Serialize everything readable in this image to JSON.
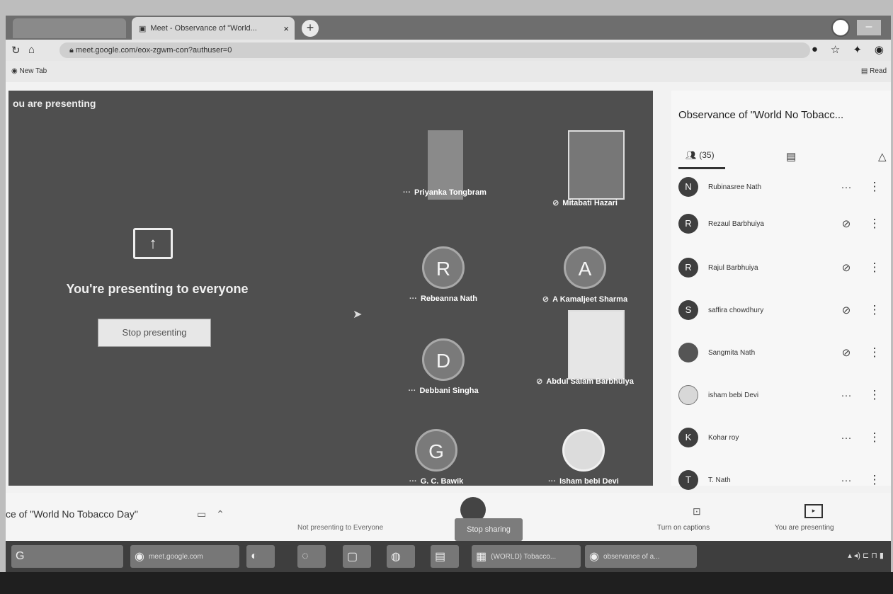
{
  "browser": {
    "tab_title": "Meet - Observance of \"World...",
    "tab_close": "×",
    "new_tab": "+",
    "url": "meet.google.com/eox-zgwm-con?authuser=0",
    "bookmark_new_tab": "New Tab",
    "bookmark_reading_list": "Read"
  },
  "stage": {
    "label": "ou are presenting",
    "message": "You're presenting to everyone",
    "stop_button": "Stop presenting"
  },
  "tiles": [
    {
      "name": "Priyanka Tongbram",
      "initial": "",
      "kind": "photo"
    },
    {
      "name": "Mitabati Hazari",
      "initial": "",
      "kind": "photo"
    },
    {
      "name": "Rebeanna Nath",
      "initial": "R",
      "kind": "avatar"
    },
    {
      "name": "A Kamaljeet Sharma",
      "initial": "A",
      "kind": "avatar"
    },
    {
      "name": "Debbani Singha",
      "initial": "D",
      "kind": "avatar"
    },
    {
      "name": "Abdul Salam Barbhuiya",
      "initial": "",
      "kind": "photo"
    },
    {
      "name": "G. C. Bawik",
      "initial": "G",
      "kind": "avatar"
    },
    {
      "name": "Isham bebi Devi",
      "initial": "",
      "kind": "photo"
    }
  ],
  "panel": {
    "title": "Observance of \"World No Tobacc...",
    "people_count": "(35)"
  },
  "participants": [
    {
      "initial": "N",
      "name": "Rubinasree Nath",
      "status": "more"
    },
    {
      "initial": "R",
      "name": "Rezaul Barbhuiya",
      "status": "muted"
    },
    {
      "initial": "R",
      "name": "Rajul Barbhuiya",
      "status": "muted"
    },
    {
      "initial": "S",
      "name": "saffira chowdhury",
      "status": "muted"
    },
    {
      "initial": "",
      "name": "Sangmita Nath",
      "status": "muted"
    },
    {
      "initial": "",
      "name": "isham bebi Devi",
      "status": "more"
    },
    {
      "initial": "K",
      "name": "Kohar roy",
      "status": "more"
    },
    {
      "initial": "T",
      "name": "T. Nath",
      "status": "more"
    }
  ],
  "bottombar": {
    "meeting_name": "ce of \"World No Tobacco Day\"",
    "hint": "Not presenting to Everyone",
    "stop_label": "Stop sharing",
    "captions_label": "Turn on captions",
    "presenting_label": "You are presenting"
  },
  "taskbar": {
    "chrome_item": "meet.google.com",
    "file_item": "(WORLD) Tobacco...",
    "browser_item": "observance of a..."
  },
  "colors": {
    "stage": "#4f4f4f",
    "panel": "#f7f7f7",
    "taskbar": "#3e3e3e"
  }
}
